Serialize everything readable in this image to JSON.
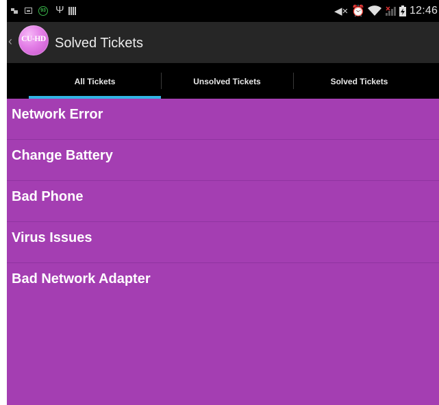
{
  "status_bar": {
    "notification_badge": "93",
    "time": "12:46",
    "icons": [
      "notification-icon",
      "image-icon",
      "badge-icon",
      "usb-icon",
      "bars-icon",
      "mute-icon",
      "alarm-icon",
      "wifi-icon",
      "signal-icon",
      "battery-icon"
    ]
  },
  "action_bar": {
    "logo_text": "CU-HD",
    "title": "Solved Tickets"
  },
  "tabs": [
    {
      "label": "All Tickets",
      "selected": true
    },
    {
      "label": "Unsolved Tickets",
      "selected": false
    },
    {
      "label": "Solved Tickets",
      "selected": false
    }
  ],
  "tickets": [
    {
      "label": "Network Error"
    },
    {
      "label": "Change Battery"
    },
    {
      "label": "Bad Phone"
    },
    {
      "label": "Virus Issues"
    },
    {
      "label": "Bad Network Adapter"
    }
  ],
  "colors": {
    "list_background": "#a43eb2",
    "tab_indicator": "#33b5e5",
    "action_bar": "#262626",
    "status_bar": "#000000"
  }
}
